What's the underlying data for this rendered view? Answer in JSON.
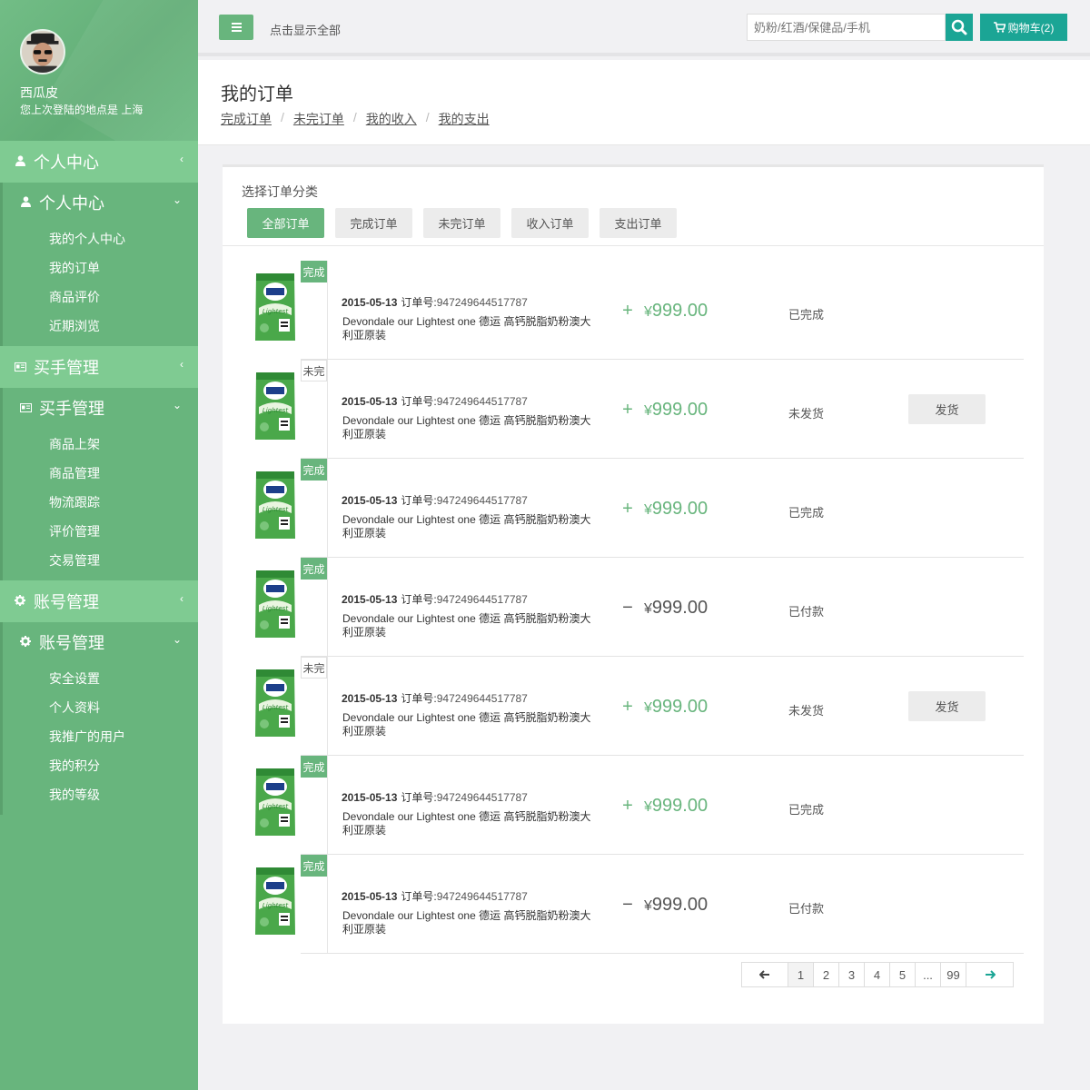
{
  "user": {
    "name": "西瓜皮",
    "last_login": "您上次登陆的地点是 上海"
  },
  "sidebar": {
    "sections": [
      {
        "title": "个人中心",
        "icon": "user-icon",
        "sub_title": "个人中心",
        "items": [
          "我的个人中心",
          "我的订单",
          "商品评价",
          "近期浏览"
        ]
      },
      {
        "title": "买手管理",
        "icon": "id-card-icon",
        "sub_title": "买手管理",
        "items": [
          "商品上架",
          "商品管理",
          "物流跟踪",
          "评价管理",
          "交易管理"
        ]
      },
      {
        "title": "账号管理",
        "icon": "gear-icon",
        "sub_title": "账号管理",
        "items": [
          "安全设置",
          "个人资料",
          "我推广的用户",
          "我的积分",
          "我的等级"
        ]
      }
    ]
  },
  "topbar": {
    "show_all": "点击显示全部",
    "search_placeholder": "奶粉/红酒/保健品/手机",
    "cart_label": "购物车(2)"
  },
  "page": {
    "title": "我的订单",
    "breadcrumb": [
      "完成订单",
      "未完订单",
      "我的收入",
      "我的支出"
    ]
  },
  "filter": {
    "label": "选择订单分类",
    "options": [
      "全部订单",
      "完成订单",
      "未完订单",
      "收入订单",
      "支出订单"
    ],
    "active": "全部订单"
  },
  "order_labels": {
    "order_no_label": "订单号:"
  },
  "orders": [
    {
      "badge": "完成",
      "badge_type": "done",
      "date": "2015-05-13",
      "order_no": "947249644517787",
      "desc": "Devondale our Lightest one 德运 高钙脱脂奶粉澳大利亚原装",
      "sign": "+",
      "currency": "¥",
      "amount": "999.00",
      "status": "已完成",
      "action": ""
    },
    {
      "badge": "未完",
      "badge_type": "undone",
      "date": "2015-05-13",
      "order_no": "947249644517787",
      "desc": "Devondale our Lightest one 德运 高钙脱脂奶粉澳大利亚原装",
      "sign": "+",
      "currency": "¥",
      "amount": "999.00",
      "status": "未发货",
      "action": "发货"
    },
    {
      "badge": "完成",
      "badge_type": "done",
      "date": "2015-05-13",
      "order_no": "947249644517787",
      "desc": "Devondale our Lightest one 德运 高钙脱脂奶粉澳大利亚原装",
      "sign": "+",
      "currency": "¥",
      "amount": "999.00",
      "status": "已完成",
      "action": ""
    },
    {
      "badge": "完成",
      "badge_type": "done",
      "date": "2015-05-13",
      "order_no": "947249644517787",
      "desc": "Devondale our Lightest one 德运 高钙脱脂奶粉澳大利亚原装",
      "sign": "−",
      "currency": "¥",
      "amount": "999.00",
      "status": "已付款",
      "action": ""
    },
    {
      "badge": "未完",
      "badge_type": "undone",
      "date": "2015-05-13",
      "order_no": "947249644517787",
      "desc": "Devondale our Lightest one 德运 高钙脱脂奶粉澳大利亚原装",
      "sign": "+",
      "currency": "¥",
      "amount": "999.00",
      "status": "未发货",
      "action": "发货"
    },
    {
      "badge": "完成",
      "badge_type": "done",
      "date": "2015-05-13",
      "order_no": "947249644517787",
      "desc": "Devondale our Lightest one 德运 高钙脱脂奶粉澳大利亚原装",
      "sign": "+",
      "currency": "¥",
      "amount": "999.00",
      "status": "已完成",
      "action": ""
    },
    {
      "badge": "完成",
      "badge_type": "done",
      "date": "2015-05-13",
      "order_no": "947249644517787",
      "desc": "Devondale our Lightest one 德运 高钙脱脂奶粉澳大利亚原装",
      "sign": "−",
      "currency": "¥",
      "amount": "999.00",
      "status": "已付款",
      "action": ""
    }
  ],
  "pagination": {
    "prev_icon": "arrow-left-icon",
    "next_icon": "arrow-right-icon",
    "pages": [
      "1",
      "2",
      "3",
      "4",
      "5",
      "...",
      "99"
    ],
    "current": "1"
  },
  "colors": {
    "brand_green": "#68b57d",
    "light_green": "#7fcb92",
    "teal": "#1ba595"
  }
}
